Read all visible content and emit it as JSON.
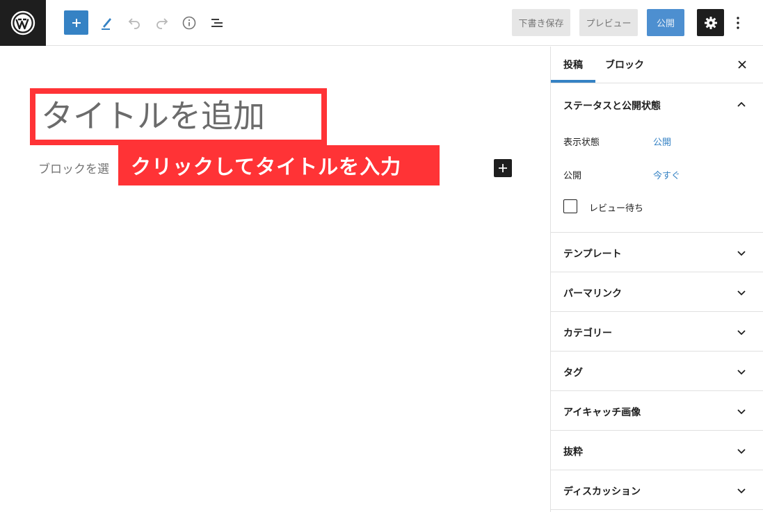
{
  "toolbar": {
    "logo_icon": "wordpress-logo",
    "add_icon": "plus-icon",
    "tools_icon": "pen-icon",
    "undo_icon": "undo-icon",
    "redo_icon": "redo-icon",
    "info_icon": "info-icon",
    "list_view_icon": "list-view-icon",
    "save_draft_label": "下書き保存",
    "preview_label": "プレビュー",
    "publish_label": "公開",
    "settings_icon": "gear-icon",
    "more_icon": "more-vertical-icon",
    "accent_color": "#3582c4"
  },
  "editor": {
    "title_placeholder": "タイトルを追加",
    "block_placeholder": "ブロックを選",
    "annotation_text": "クリックしてタイトルを入力",
    "annotation_color": "#ff3336",
    "inline_add_icon": "plus-icon"
  },
  "sidebar": {
    "tabs": [
      {
        "label": "投稿",
        "active": true
      },
      {
        "label": "ブロック",
        "active": false
      }
    ],
    "close_icon": "close-icon",
    "status_panel": {
      "title": "ステータスと公開状態",
      "rows": [
        {
          "label": "表示状態",
          "value": "公開"
        },
        {
          "label": "公開",
          "value": "今すぐ"
        }
      ],
      "pending_review_label": "レビュー待ち",
      "pending_review_checked": false
    },
    "panels": [
      {
        "title": "テンプレート"
      },
      {
        "title": "パーマリンク"
      },
      {
        "title": "カテゴリー"
      },
      {
        "title": "タグ"
      },
      {
        "title": "アイキャッチ画像"
      },
      {
        "title": "抜粋"
      },
      {
        "title": "ディスカッション"
      }
    ]
  }
}
